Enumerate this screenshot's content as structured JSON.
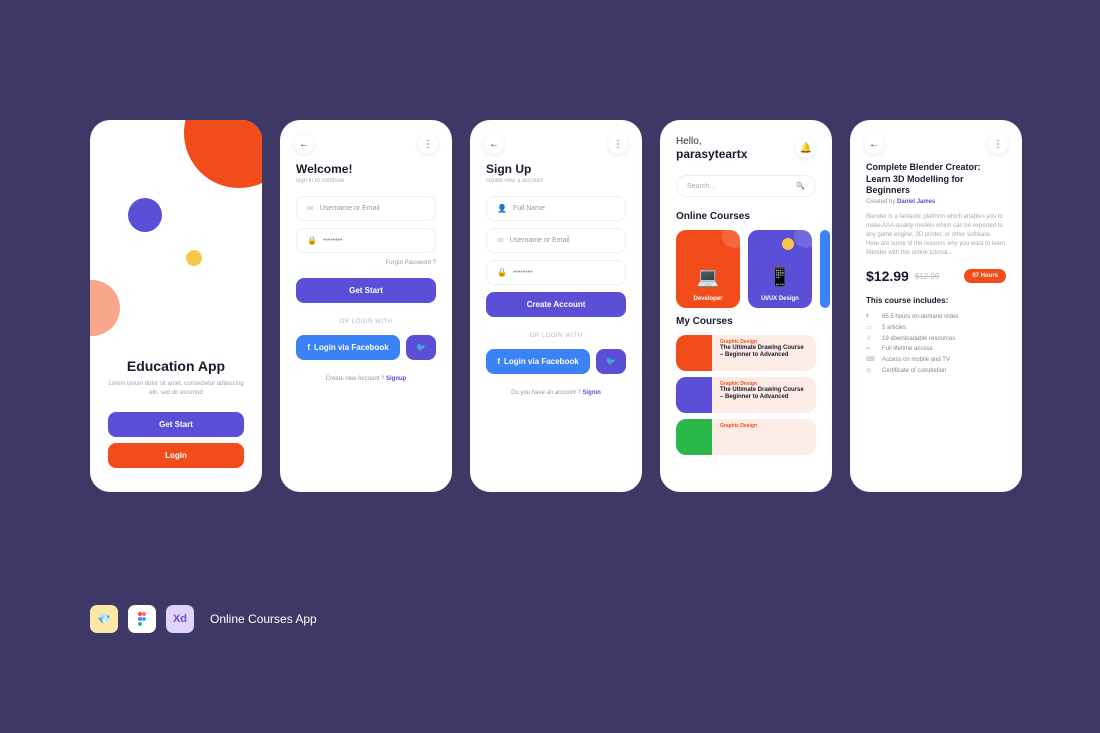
{
  "footer": {
    "title": "Online Courses App",
    "badges": {
      "xd": "Xd"
    }
  },
  "screen1": {
    "title": "Education App",
    "subtitle": "Lorem ipsum dolor sit amet, consectetur adipiscing elit, sed do eiusmod",
    "get_start": "Get Start",
    "login": "Login"
  },
  "screen2": {
    "title": "Welcome!",
    "subtitle": "sign in to continue",
    "username_ph": "Username or Email",
    "password_ph": "••••••••",
    "forgot": "Forgot Password ?",
    "get_start": "Get Start",
    "or": "OR LOGIN WITH",
    "facebook": "Login via Facebook",
    "create_q": "Create new Account ?",
    "signup": "Signup"
  },
  "screen3": {
    "title": "Sign Up",
    "subtitle": "create new a account",
    "fullname_ph": "Full Name",
    "username_ph": "Username or Email",
    "password_ph": "••••••••",
    "create": "Create Account",
    "or": "OR LOGIN WITH",
    "facebook": "Login via Facebook",
    "have_q": "Do you have an account ?",
    "signin": "Signin"
  },
  "screen4": {
    "hello": "Hello,",
    "username": "parasyteartx",
    "search_ph": "Search...",
    "section1": "Online Courses",
    "cards": [
      {
        "label": "Developer"
      },
      {
        "label": "UI/UX Design"
      }
    ],
    "section2": "My Courses",
    "mycourses": [
      {
        "cat": "Graphic Design",
        "title": "The Ultimate Drawing Course – Beginner to Advanced"
      },
      {
        "cat": "Graphic Design",
        "title": "The Ultimate Drawing Course – Beginner to Advanced"
      },
      {
        "cat": "Graphic Design",
        "title": ""
      }
    ]
  },
  "screen5": {
    "title": "Complete Blender Creator: Learn 3D Modelling for Beginners",
    "created_by": "Created by",
    "author": "Daniel James",
    "desc": "Blender is a fantastic platform which enables you to make AAA-quality models which can be exported to any game engine, 3D printer, or other software. Here are some of the reasons why you want to learn Blender with this online tutorial...",
    "price": "$12.99",
    "old_price": "$12.99",
    "hours": "07 Hours",
    "includes_title": "This course includes:",
    "includes": [
      "85.5 hours on-demand video",
      "5 articles",
      "19 downloadable resources",
      "Full lifetime access",
      "Access on mobile and TV",
      "Certificate of completion"
    ]
  }
}
